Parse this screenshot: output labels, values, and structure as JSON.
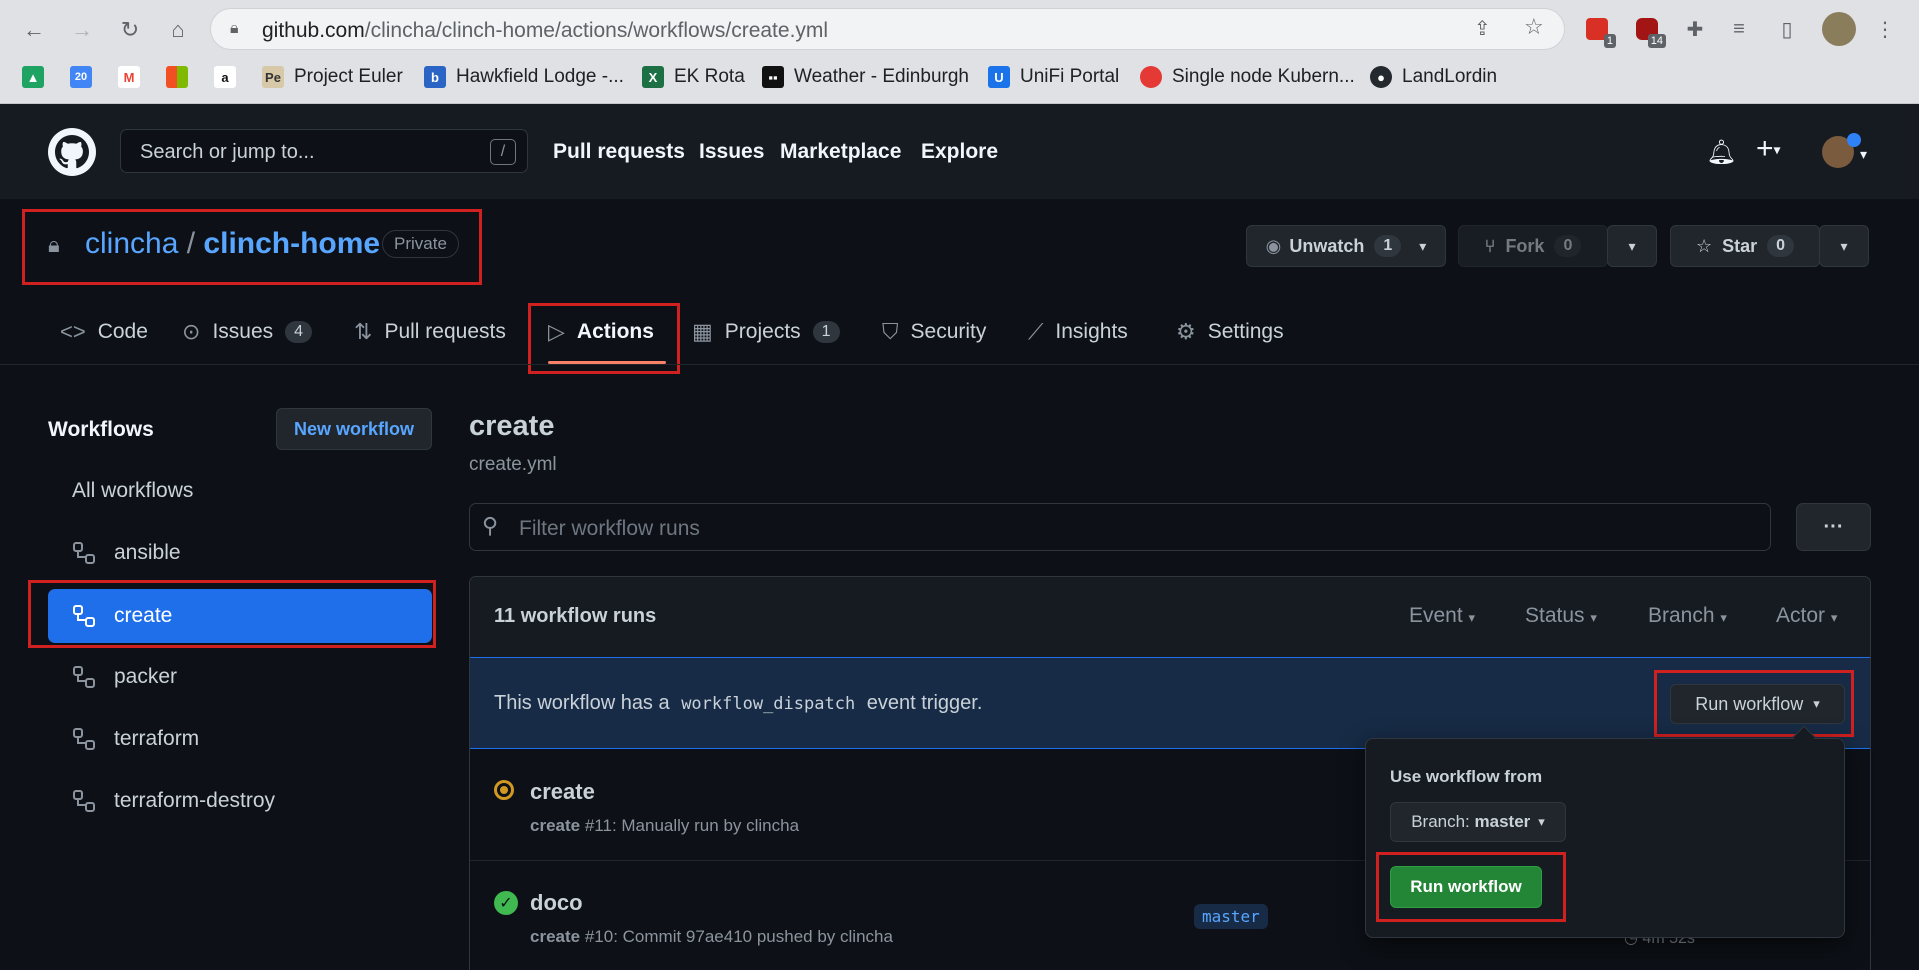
{
  "browser": {
    "url_host": "github.com",
    "url_path": "/clincha/clinch-home/actions/workflows/create.yml",
    "extensions": [
      {
        "name": "ext-1",
        "badge": "1"
      },
      {
        "name": "ext-2",
        "badge": "14"
      }
    ],
    "bookmarks": [
      "Project Euler",
      "Hawkfield Lodge -...",
      "EK Rota",
      "Weather - Edinburgh",
      "UniFi Portal",
      "Single node Kubern...",
      "LandLordin"
    ]
  },
  "header": {
    "search_placeholder": "Search or jump to...",
    "search_key": "/",
    "links": [
      "Pull requests",
      "Issues",
      "Marketplace",
      "Explore"
    ]
  },
  "repo": {
    "owner": "clincha",
    "separator": "/",
    "name": "clinch-home",
    "visibility": "Private",
    "unwatch_label": "Unwatch",
    "unwatch_count": "1",
    "fork_label": "Fork",
    "fork_count": "0",
    "star_label": "Star",
    "star_count": "0"
  },
  "tabs": [
    {
      "label": "Code"
    },
    {
      "label": "Issues",
      "count": "4"
    },
    {
      "label": "Pull requests"
    },
    {
      "label": "Actions"
    },
    {
      "label": "Projects",
      "count": "1"
    },
    {
      "label": "Security"
    },
    {
      "label": "Insights"
    },
    {
      "label": "Settings"
    }
  ],
  "sidebar": {
    "title": "Workflows",
    "new_workflow": "New workflow",
    "all": "All workflows",
    "items": [
      "ansible",
      "create",
      "packer",
      "terraform",
      "terraform-destroy"
    ]
  },
  "main": {
    "title": "create",
    "file": "create.yml",
    "filter_placeholder": "Filter workflow runs",
    "more": "···",
    "runs_count": "11 workflow runs",
    "filters": [
      "Event",
      "Status",
      "Branch",
      "Actor"
    ],
    "dispatch_pre": "This workflow has a",
    "dispatch_code": "workflow_dispatch",
    "dispatch_post": "event trigger.",
    "run_workflow_btn": "Run workflow",
    "runs": [
      {
        "name": "create",
        "workflow": "create",
        "meta": "#11: Manually run by clincha",
        "status": "in-progress"
      },
      {
        "name": "doco",
        "workflow": "create",
        "meta": "#10: Commit 97ae410 pushed by clincha",
        "status": "success",
        "branch": "master",
        "duration": "4m 52s"
      }
    ]
  },
  "popover": {
    "title": "Use workflow from",
    "branch_prefix": "Branch:",
    "branch": "master",
    "run_btn": "Run workflow"
  },
  "colors": {
    "accent": "#2f81f7",
    "success": "#238636",
    "annotation": "#d0201f",
    "warning": "#d29922"
  }
}
